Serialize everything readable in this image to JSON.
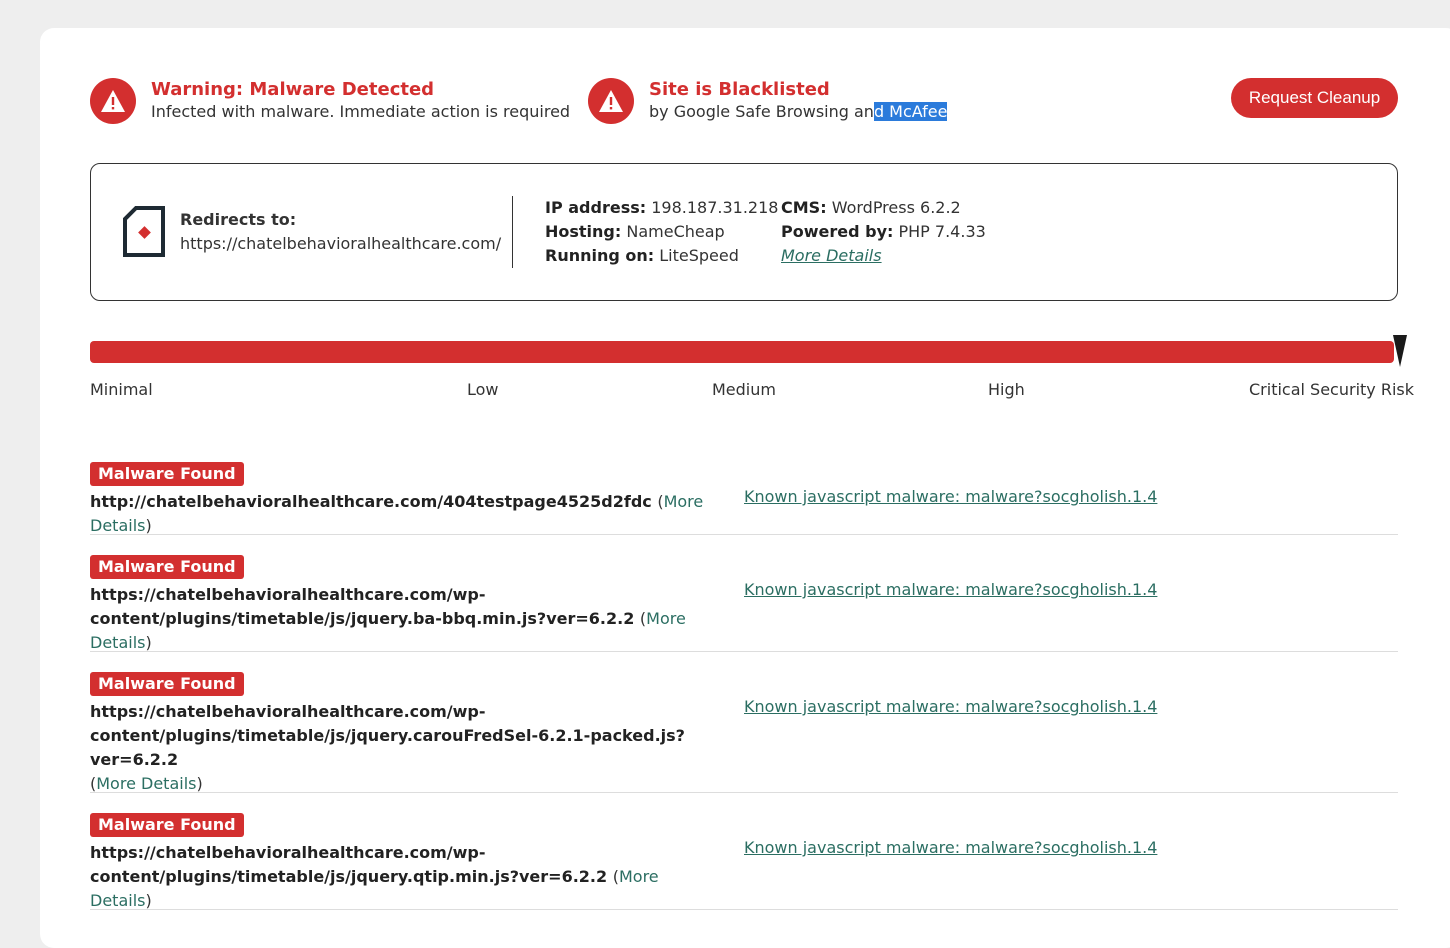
{
  "alerts": {
    "malware": {
      "title": "Warning: Malware Detected",
      "desc": "Infected with malware. Immediate action is required"
    },
    "blacklist": {
      "title": "Site is Blacklisted",
      "desc_before": "by Google Safe Browsing an",
      "desc_selected": "d McAfee"
    }
  },
  "cleanup_button": "Request Cleanup",
  "site_info": {
    "redirect_label": "Redirects to:",
    "redirect_url": "https://chatelbehavioralhealthcare.com/",
    "ip_label": "IP address:",
    "ip_value": "198.187.31.218",
    "hosting_label": "Hosting:",
    "hosting_value": "NameCheap",
    "running_label": "Running on:",
    "running_value": "LiteSpeed",
    "cms_label": "CMS:",
    "cms_value": "WordPress 6.2.2",
    "powered_label": "Powered by:",
    "powered_value": "PHP 7.4.33",
    "more_details": "More Details"
  },
  "risk": {
    "labels": [
      "Minimal",
      "Low",
      "Medium",
      "High",
      "Critical Security Risk"
    ],
    "level": "Critical Security Risk",
    "level_fraction": 1.0
  },
  "findings": [
    {
      "badge": "Malware Found",
      "url": "http://chatelbehavioralhealthcare.com/404testpage4525d2fdc",
      "more": "More Details",
      "signature": "Known javascript malware: malware?socgholish.1.4"
    },
    {
      "badge": "Malware Found",
      "url_line1": "https://chatelbehavioralhealthcare.com/wp-",
      "url_line2": "content/plugins/timetable/js/jquery.ba-bbq.min.js?ver=6.2.2",
      "more": "More Details",
      "signature": "Known javascript malware: malware?socgholish.1.4"
    },
    {
      "badge": "Malware Found",
      "url_line1": "https://chatelbehavioralhealthcare.com/wp-",
      "url_line2": "content/plugins/timetable/js/jquery.carouFredSel-6.2.1-packed.js?ver=6.2.2",
      "more": "More Details",
      "signature": "Known javascript malware: malware?socgholish.1.4"
    },
    {
      "badge": "Malware Found",
      "url_line1": "https://chatelbehavioralhealthcare.com/wp-",
      "url_line2": "content/plugins/timetable/js/jquery.qtip.min.js?ver=6.2.2",
      "more": "More Details",
      "signature": "Known javascript malware: malware?socgholish.1.4"
    }
  ],
  "colors": {
    "accent_red": "#d32f2f",
    "link_green": "#2b6e62",
    "selection": "#2b7bdb"
  }
}
